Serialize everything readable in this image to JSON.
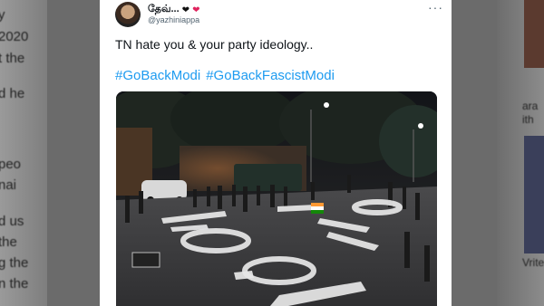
{
  "background": {
    "left_lines": [
      "y",
      "2020",
      "t the",
      "",
      "d he",
      "",
      "",
      "peo",
      "nai",
      "",
      "d us",
      "the",
      "g the",
      "n the"
    ],
    "right_lines": [
      "ara",
      "ith",
      "Vrite"
    ]
  },
  "tweet": {
    "display_name": "தேவ்...",
    "handle": "@yazhiniappa",
    "more_label": "···",
    "text": "TN hate you & your party ideology..",
    "hashtags": [
      "#GoBackModi",
      "#GoBackFascistModi"
    ],
    "photo_road_text": "GO BACK MODI"
  },
  "colors": {
    "hashtag": "#1d9bf0",
    "heart": "#e0245e"
  }
}
